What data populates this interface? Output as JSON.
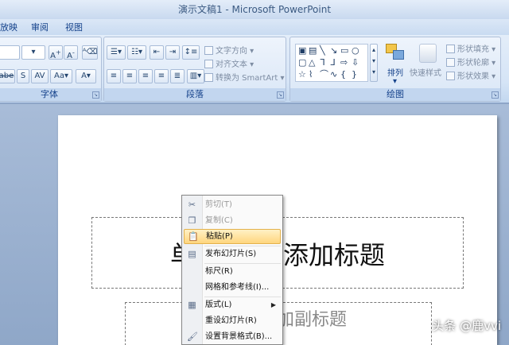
{
  "window": {
    "title": "演示文稿1 - Microsoft PowerPoint"
  },
  "ribbon_tabs": [
    {
      "label": "放映"
    },
    {
      "label": "审阅"
    },
    {
      "label": "视图"
    }
  ],
  "ribbon": {
    "font_group": {
      "label": "字体"
    },
    "paragraph_group": {
      "label": "段落",
      "text_direction": "文字方向",
      "align_text": "对齐文本",
      "convert_smartart": "转换为 SmartArt"
    },
    "drawing_group": {
      "label": "绘图",
      "arrange": "排列",
      "quick_styles": "快速样式",
      "shape_fill": "形状填充",
      "shape_outline": "形状轮廓",
      "shape_effects": "形状效果"
    }
  },
  "slide": {
    "title_placeholder_left": "单",
    "title_placeholder_right": "添加标题",
    "subtitle_placeholder": "加副标题"
  },
  "context_menu": {
    "items": [
      {
        "label": "剪切(T)",
        "icon": "scissors-icon",
        "enabled": false
      },
      {
        "label": "复制(C)",
        "icon": "copy-icon",
        "enabled": false
      },
      {
        "label": "粘贴(P)",
        "icon": "paste-icon",
        "enabled": true,
        "highlighted": true
      },
      {
        "label": "发布幻灯片(S)",
        "icon": "publish-slides-icon",
        "enabled": true
      },
      {
        "label": "标尺(R)",
        "enabled": true
      },
      {
        "label": "网格和参考线(I)...",
        "enabled": true
      },
      {
        "label": "版式(L)",
        "icon": "layout-icon",
        "enabled": true,
        "submenu": true
      },
      {
        "label": "重设幻灯片(R)",
        "enabled": true
      },
      {
        "label": "设置背景格式(B)...",
        "icon": "background-format-icon",
        "enabled": true
      }
    ]
  },
  "watermark": "头条 @鹿vvi"
}
